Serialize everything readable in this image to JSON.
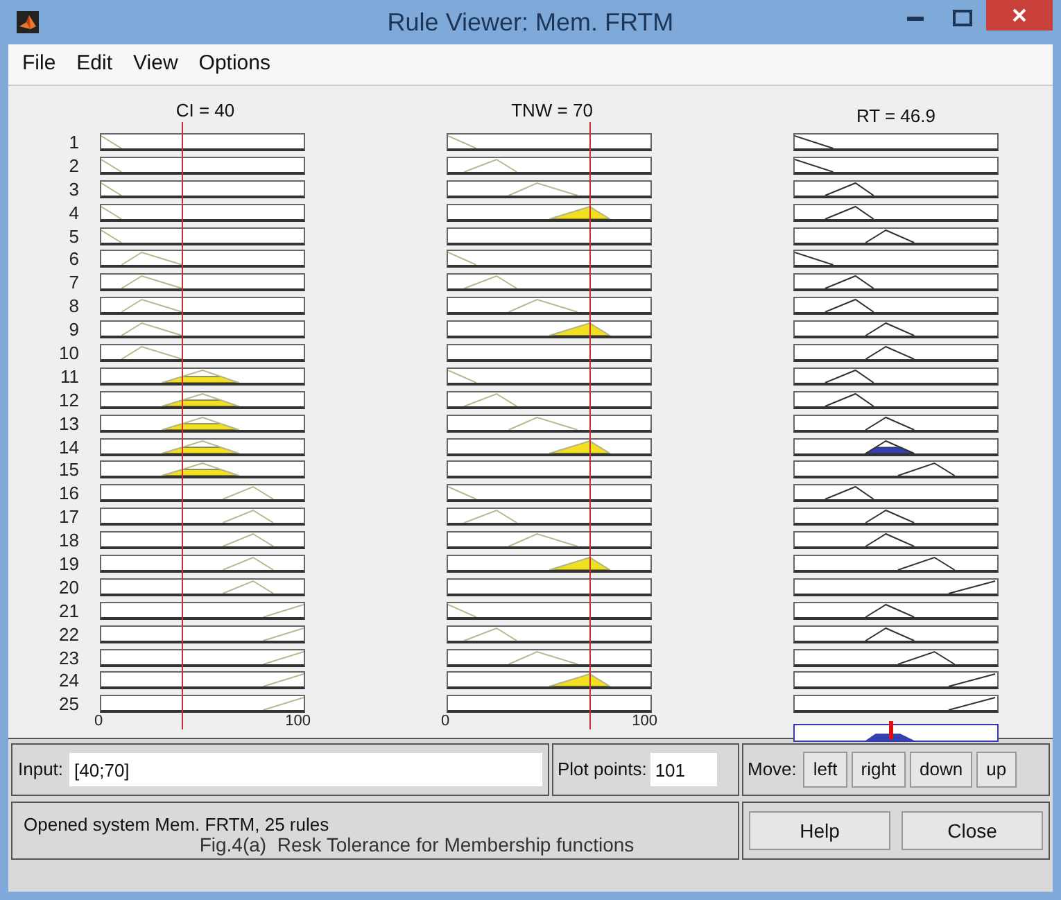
{
  "window": {
    "title": "Rule Viewer: Mem. FRTM"
  },
  "menu": [
    "File",
    "Edit",
    "View",
    "Options"
  ],
  "variables": [
    {
      "kind": "input",
      "label": "CI = 40",
      "level": 0.4,
      "axis": [
        "0",
        "100"
      ]
    },
    {
      "kind": "input",
      "label": "TNW = 70",
      "level": 0.7,
      "axis": [
        "0",
        "100"
      ]
    },
    {
      "kind": "output",
      "label": "RT = 46.9",
      "level": 0.469
    }
  ],
  "rules": [
    {
      "number": "1",
      "cells": [
        {
          "kind": "mf1"
        },
        {
          "kind": "mf1"
        },
        {
          "kind": "mf1"
        }
      ]
    },
    {
      "number": "2",
      "cells": [
        {
          "kind": "mf1"
        },
        {
          "kind": "mf2"
        },
        {
          "kind": "mf1"
        }
      ]
    },
    {
      "number": "3",
      "cells": [
        {
          "kind": "mf1"
        },
        {
          "kind": "mf3"
        },
        {
          "kind": "mf2"
        }
      ]
    },
    {
      "number": "4",
      "cells": [
        {
          "kind": "mf1"
        },
        {
          "kind": "mf4"
        },
        {
          "kind": "mf2"
        }
      ]
    },
    {
      "number": "5",
      "cells": [
        {
          "kind": "mf1"
        },
        {
          "kind": "none"
        },
        {
          "kind": "mf3"
        }
      ]
    },
    {
      "number": "6",
      "cells": [
        {
          "kind": "mf2"
        },
        {
          "kind": "mf1"
        },
        {
          "kind": "mf1"
        }
      ]
    },
    {
      "number": "7",
      "cells": [
        {
          "kind": "mf2"
        },
        {
          "kind": "mf2"
        },
        {
          "kind": "mf2"
        }
      ]
    },
    {
      "number": "8",
      "cells": [
        {
          "kind": "mf2"
        },
        {
          "kind": "mf3"
        },
        {
          "kind": "mf2"
        }
      ]
    },
    {
      "number": "9",
      "cells": [
        {
          "kind": "mf2"
        },
        {
          "kind": "mf4"
        },
        {
          "kind": "mf3"
        }
      ]
    },
    {
      "number": "10",
      "cells": [
        {
          "kind": "mf2"
        },
        {
          "kind": "none"
        },
        {
          "kind": "mf3"
        }
      ]
    },
    {
      "number": "11",
      "cells": [
        {
          "kind": "mf3"
        },
        {
          "kind": "mf1"
        },
        {
          "kind": "mf2"
        }
      ]
    },
    {
      "number": "12",
      "cells": [
        {
          "kind": "mf3"
        },
        {
          "kind": "mf2"
        },
        {
          "kind": "mf2"
        }
      ]
    },
    {
      "number": "13",
      "cells": [
        {
          "kind": "mf3"
        },
        {
          "kind": "mf3"
        },
        {
          "kind": "mf3"
        }
      ]
    },
    {
      "number": "14",
      "cells": [
        {
          "kind": "mf3"
        },
        {
          "kind": "mf4"
        },
        {
          "kind": "mf3"
        }
      ]
    },
    {
      "number": "15",
      "cells": [
        {
          "kind": "mf3"
        },
        {
          "kind": "none"
        },
        {
          "kind": "mf4"
        }
      ]
    },
    {
      "number": "16",
      "cells": [
        {
          "kind": "mf4"
        },
        {
          "kind": "mf1"
        },
        {
          "kind": "mf2"
        }
      ]
    },
    {
      "number": "17",
      "cells": [
        {
          "kind": "mf4"
        },
        {
          "kind": "mf2"
        },
        {
          "kind": "mf3"
        }
      ]
    },
    {
      "number": "18",
      "cells": [
        {
          "kind": "mf4"
        },
        {
          "kind": "mf3"
        },
        {
          "kind": "mf3"
        }
      ]
    },
    {
      "number": "19",
      "cells": [
        {
          "kind": "mf4"
        },
        {
          "kind": "mf4"
        },
        {
          "kind": "mf4"
        }
      ]
    },
    {
      "number": "20",
      "cells": [
        {
          "kind": "mf4"
        },
        {
          "kind": "none"
        },
        {
          "kind": "mf5"
        }
      ]
    },
    {
      "number": "21",
      "cells": [
        {
          "kind": "mf5"
        },
        {
          "kind": "mf1"
        },
        {
          "kind": "mf3"
        }
      ]
    },
    {
      "number": "22",
      "cells": [
        {
          "kind": "mf5"
        },
        {
          "kind": "mf2"
        },
        {
          "kind": "mf3"
        }
      ]
    },
    {
      "number": "23",
      "cells": [
        {
          "kind": "mf5"
        },
        {
          "kind": "mf3"
        },
        {
          "kind": "mf4"
        }
      ]
    },
    {
      "number": "24",
      "cells": [
        {
          "kind": "mf5"
        },
        {
          "kind": "mf4"
        },
        {
          "kind": "mf5"
        }
      ]
    },
    {
      "number": "25",
      "cells": [
        {
          "kind": "mf5"
        },
        {
          "kind": "none"
        },
        {
          "kind": "mf5"
        }
      ]
    }
  ],
  "input": {
    "label": "Input:",
    "value": "[40;70]"
  },
  "plot_points": {
    "label": "Plot points:",
    "value": "101"
  },
  "move": {
    "label": "Move:",
    "buttons": [
      "left",
      "right",
      "down",
      "up"
    ]
  },
  "status": "Opened system Mem. FRTM, 25 rules",
  "caption": "Fig.4(a)  Resk Tolerance for Membership functions",
  "buttons": [
    "Help",
    "Close"
  ]
}
